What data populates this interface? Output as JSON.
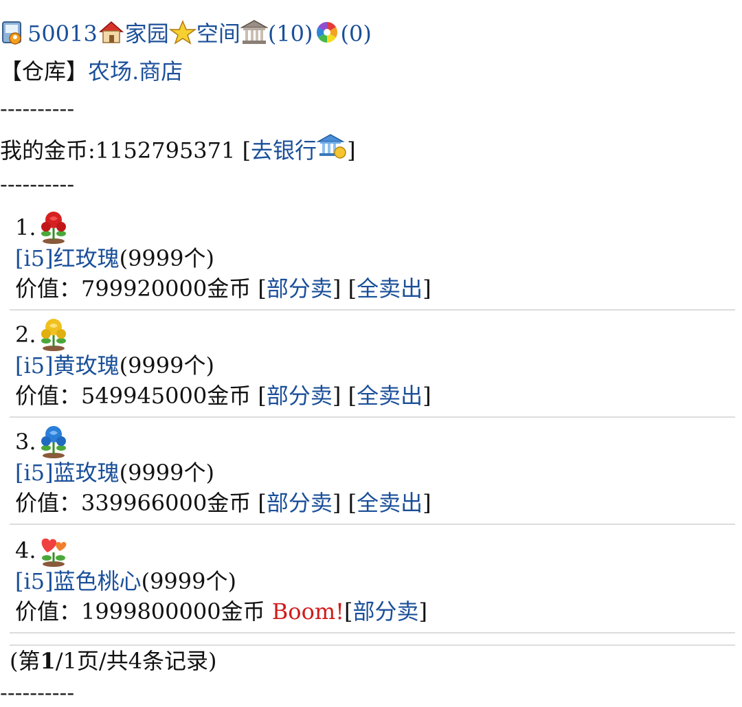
{
  "header": {
    "user_id": "50013",
    "home_label": "家园",
    "space_label": "空间",
    "bank_count": "(10)",
    "wheel_count": "(0)"
  },
  "nav": {
    "bracket_open": "【",
    "current": "仓库",
    "bracket_close": "】",
    "farm_link": "农场",
    "dot": ".",
    "shop_link": "商店"
  },
  "separator": "----------",
  "gold": {
    "label": "我的金币:1152795371 ",
    "bracket_open": "[",
    "bank_link": "去银行",
    "bracket_close": "]"
  },
  "items": [
    {
      "index": "1.",
      "tag": "[i5]",
      "name": "红玫瑰",
      "count": "(9999个)",
      "value_text": "价值：799920000金币 ",
      "partial_sell": "部分卖",
      "sell_all": "全卖出",
      "icon": "red-rose-icon",
      "color": "#d62020"
    },
    {
      "index": "2.",
      "tag": "[i5]",
      "name": "黄玫瑰",
      "count": "(9999个)",
      "value_text": "价值：549945000金币 ",
      "partial_sell": "部分卖",
      "sell_all": "全卖出",
      "icon": "yellow-rose-icon",
      "color": "#f0c020"
    },
    {
      "index": "3.",
      "tag": "[i5]",
      "name": "蓝玫瑰",
      "count": "(9999个)",
      "value_text": "价值：339966000金币 ",
      "partial_sell": "部分卖",
      "sell_all": "全卖出",
      "icon": "blue-rose-icon",
      "color": "#2a7fd8"
    },
    {
      "index": "4.",
      "tag": "[i5]",
      "name": "蓝色桃心",
      "count": "(9999个)",
      "value_text": "价值：1999800000金币 ",
      "boom": "Boom!",
      "partial_sell": "部分卖",
      "icon": "heart-flower-icon",
      "color": "#f04040"
    }
  ],
  "pager": {
    "open": "(第",
    "current_page": "1",
    "rest": "/1页/共4条记录)"
  }
}
